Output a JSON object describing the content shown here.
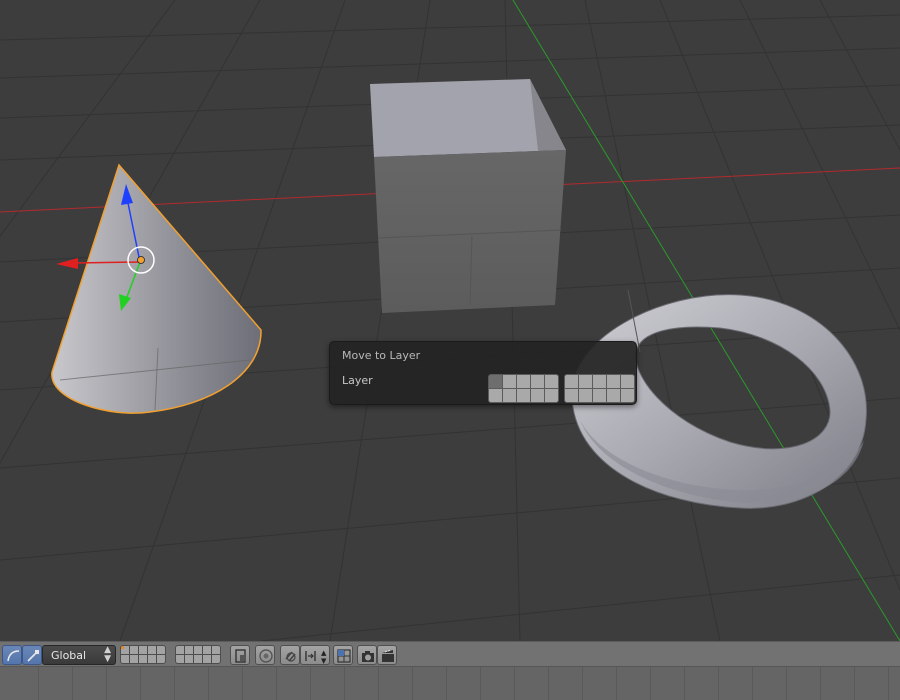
{
  "popup": {
    "title": "Move to Layer",
    "label": "Layer",
    "active_layer_index": 0
  },
  "toolbar": {
    "orientation_value": "Global",
    "orientation_arrows": "▲▼",
    "icons": [
      "rotate-manipulator-icon",
      "scale-manipulator-icon",
      "render-layer-icon",
      "proportional-edit-icon",
      "snap-icon",
      "snap-element-icon",
      "copy-layers-icon",
      "render-still-icon",
      "render-animation-icon"
    ]
  },
  "colors": {
    "viewport_bg": "#3d3d3d",
    "grid": "#333333",
    "x_axis": "#c8282d",
    "y_axis": "#2c9e2c",
    "selection_outline": "#f0a030",
    "manipulator_x": "#e02020",
    "manipulator_y": "#22d022",
    "manipulator_z": "#2040ff"
  }
}
